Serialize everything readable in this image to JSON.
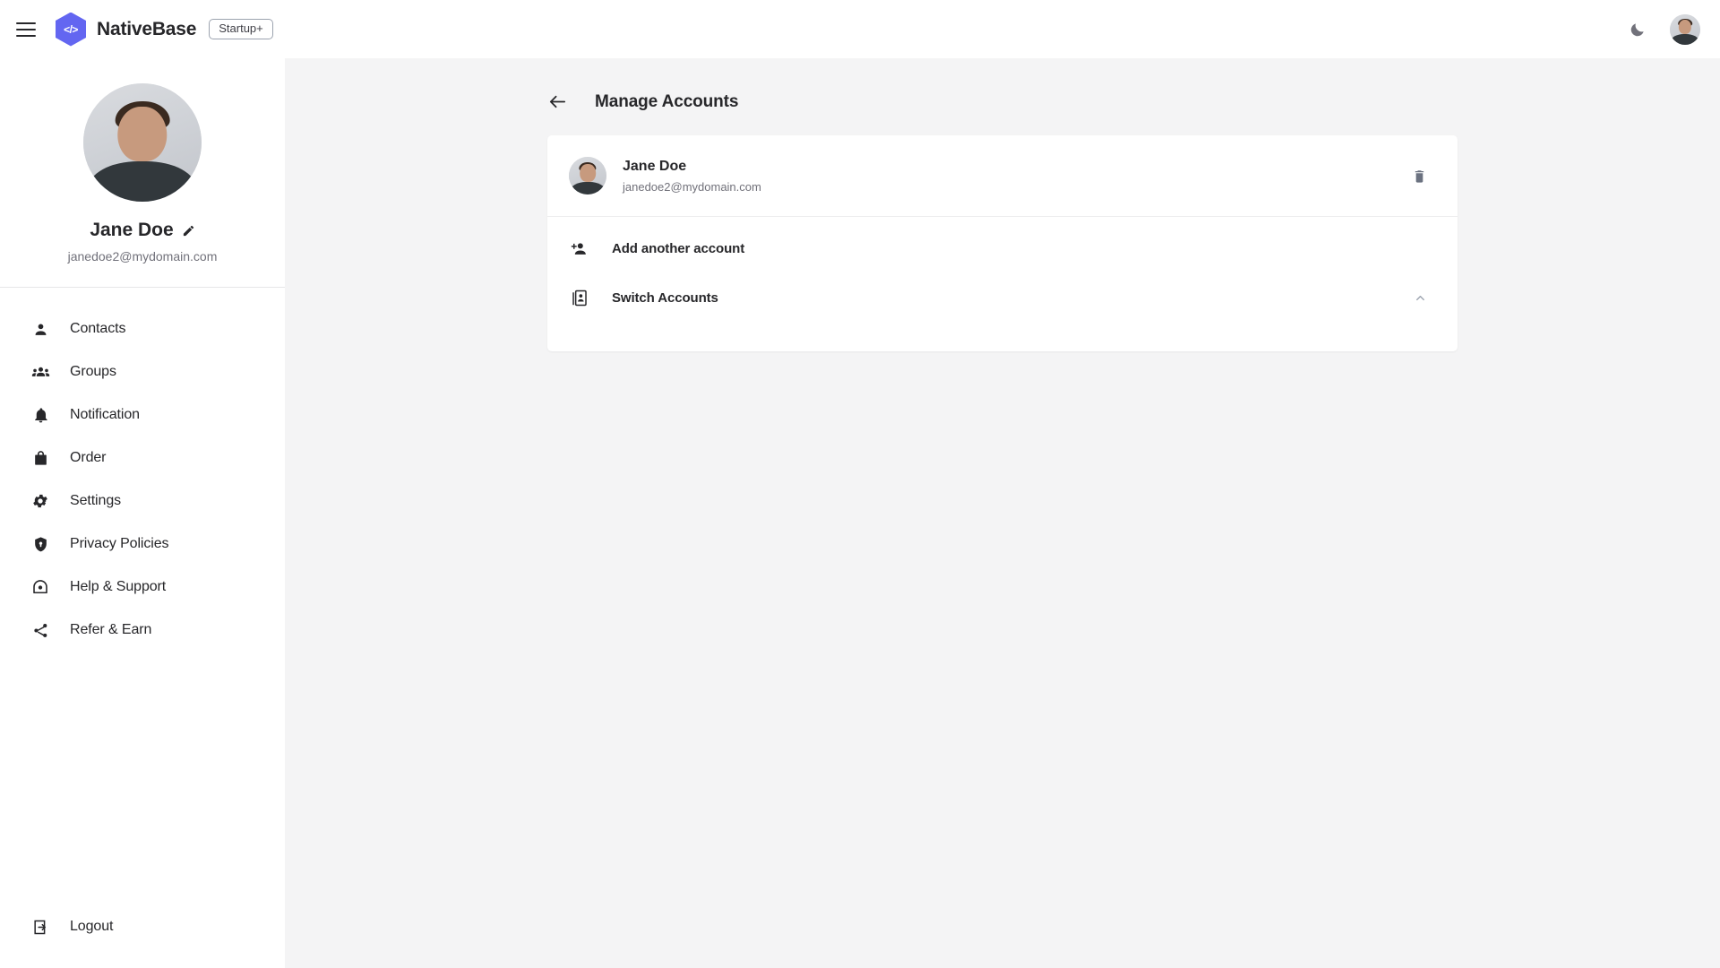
{
  "topbar": {
    "menu_icon": "hamburger-menu-icon",
    "logo_glyph": "</>",
    "brand": "NativeBase",
    "plan_badge": "Startup+",
    "theme_toggle_icon": "moon-icon",
    "avatar_icon": "user-avatar"
  },
  "sidebar": {
    "profile": {
      "name": "Jane Doe",
      "email": "janedoe2@mydomain.com",
      "edit_icon": "pencil-icon"
    },
    "items": [
      {
        "label": "Contacts",
        "icon": "person-icon"
      },
      {
        "label": "Groups",
        "icon": "people-group-icon"
      },
      {
        "label": "Notification",
        "icon": "bell-icon"
      },
      {
        "label": "Order",
        "icon": "shopping-bag-icon"
      },
      {
        "label": "Settings",
        "icon": "gear-icon"
      },
      {
        "label": "Privacy Policies",
        "icon": "shield-lock-icon"
      },
      {
        "label": "Help & Support",
        "icon": "help-headset-icon"
      },
      {
        "label": "Refer & Earn",
        "icon": "share-icon"
      }
    ],
    "logout": {
      "label": "Logout",
      "icon": "logout-icon"
    }
  },
  "main": {
    "back_icon": "arrow-left-icon",
    "title": "Manage Accounts",
    "account": {
      "name": "Jane Doe",
      "email": "janedoe2@mydomain.com",
      "delete_icon": "trash-icon"
    },
    "actions": [
      {
        "label": "Add another account",
        "icon": "person-add-icon",
        "chevron": ""
      },
      {
        "label": "Switch Accounts",
        "icon": "switch-account-icon",
        "chevron": "chevron-up-icon"
      }
    ]
  },
  "colors": {
    "brand_purple": "#6366f1",
    "text_primary": "#27272a",
    "text_muted": "#71717a",
    "page_bg": "#f4f4f5",
    "card_bg": "#ffffff"
  }
}
